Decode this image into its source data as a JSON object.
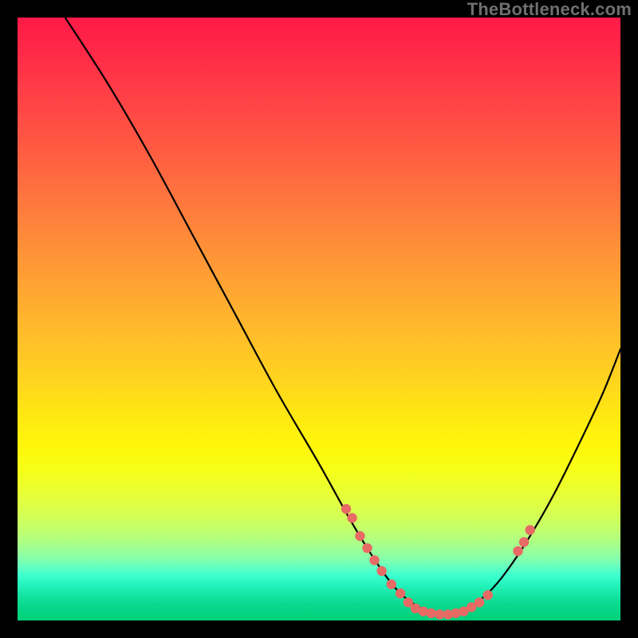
{
  "watermark": "TheBottleneck.com",
  "chart_data": {
    "type": "line",
    "title": "",
    "xlabel": "",
    "ylabel": "",
    "xlim": [
      0,
      100
    ],
    "ylim": [
      0,
      100
    ],
    "grid": false,
    "series": [
      {
        "name": "curve",
        "x": [
          7.9,
          15.0,
          22.0,
          29.0,
          36.0,
          43.0,
          50.0,
          55.0,
          58.0,
          61.0,
          63.0,
          65.0,
          67.0,
          69.0,
          71.0,
          73.0,
          75.0,
          78.0,
          81.0,
          85.0,
          89.0,
          93.0,
          97.0,
          100.0
        ],
        "values": [
          100.0,
          89.0,
          77.0,
          64.0,
          51.0,
          38.0,
          26.0,
          17.0,
          12.0,
          7.5,
          5.0,
          3.2,
          2.0,
          1.3,
          1.0,
          1.3,
          2.2,
          4.5,
          8.0,
          14.0,
          21.0,
          29.0,
          37.5,
          45.0
        ]
      }
    ],
    "markers": [
      {
        "name": "left-dots",
        "color": "#e86a65",
        "x": [
          54.5,
          55.5,
          56.8,
          58.0,
          59.2,
          60.4,
          62.0,
          63.5
        ],
        "values": [
          18.5,
          17.0,
          14.0,
          12.0,
          10.0,
          8.2,
          6.0,
          4.5
        ]
      },
      {
        "name": "bottom-dots",
        "color": "#e86a65",
        "x": [
          64.8,
          66.0,
          67.3,
          68.6,
          70.0,
          71.4,
          72.7,
          74.0,
          75.3,
          76.6,
          78.0
        ],
        "values": [
          3.0,
          2.0,
          1.5,
          1.2,
          1.0,
          1.0,
          1.2,
          1.5,
          2.2,
          3.0,
          4.2
        ]
      },
      {
        "name": "right-dots",
        "color": "#e86a65",
        "x": [
          83.0,
          84.0,
          85.0
        ],
        "values": [
          11.5,
          13.0,
          15.0
        ]
      }
    ]
  }
}
